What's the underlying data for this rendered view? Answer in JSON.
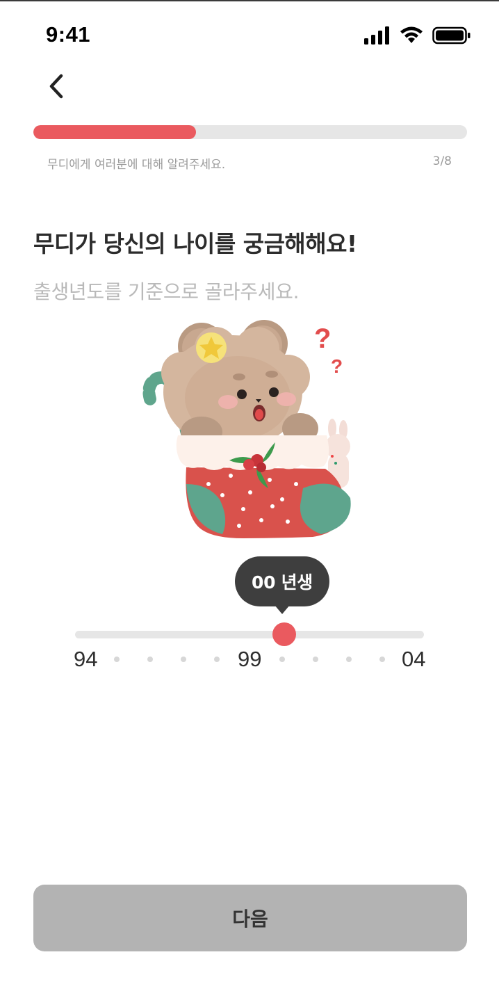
{
  "status_bar": {
    "time": "9:41",
    "icons": [
      "cellular-signal-icon",
      "wifi-icon",
      "battery-icon"
    ]
  },
  "header": {
    "back_icon": "chevron-left-icon"
  },
  "progress": {
    "label": "무디에게 여러분에 대해 알려주세요.",
    "step_text": "3/8",
    "fraction": 0.375,
    "color": "#ea5a5f"
  },
  "question": {
    "title": "무디가 당신의 나이를 궁금해해요!",
    "subtitle": "출생년도를 기준으로 골라주세요."
  },
  "slider": {
    "tooltip": "00 년생",
    "labels": [
      "94",
      "99",
      "04"
    ],
    "selected_fraction": 0.6,
    "thumb_color": "#ea5a5f"
  },
  "footer": {
    "next_label": "다음"
  }
}
